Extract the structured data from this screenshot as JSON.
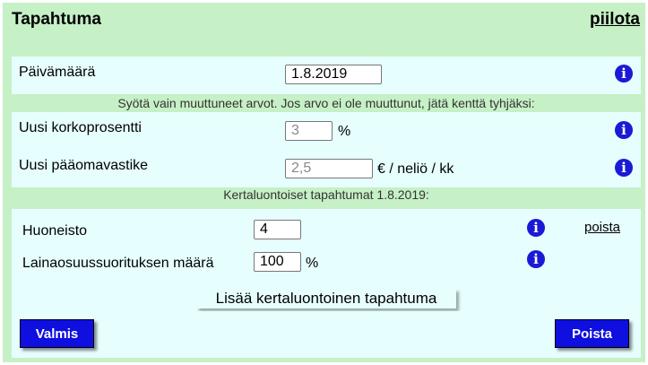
{
  "header": {
    "title": "Tapahtuma",
    "hide_link": "piilota"
  },
  "date_row": {
    "label": "Päivämäärä",
    "value": "1.8.2019",
    "info_icon": "info-icon"
  },
  "instruction": "Syötä vain muuttuneet arvot. Jos arvo ei ole muuttunut, jätä kenttä tyhjäksi:",
  "interest_row": {
    "label": "Uusi korkoprosentti",
    "placeholder": "3",
    "unit": "%"
  },
  "capital_row": {
    "label": "Uusi pääomavastike",
    "placeholder": "2,5",
    "unit": "€ / neliö / kk"
  },
  "one_time_header": "Kertaluontoiset tapahtumat 1.8.2019:",
  "one_time": {
    "apartment_label": "Huoneisto",
    "apartment_value": "4",
    "remove_link": "poista",
    "loan_label": "Lainaosuussuorituksen määrä",
    "loan_value": "100",
    "loan_unit": "%"
  },
  "add_button": "Lisää kertaluontoinen tapahtuma",
  "footer": {
    "done_button": "Valmis",
    "delete_button": "Poista"
  },
  "colors": {
    "panel_bg": "#c6f0c6",
    "row_bg": "#e6fefe",
    "button_blue": "#0f0fe0",
    "info_blue": "#1a1ad6"
  }
}
